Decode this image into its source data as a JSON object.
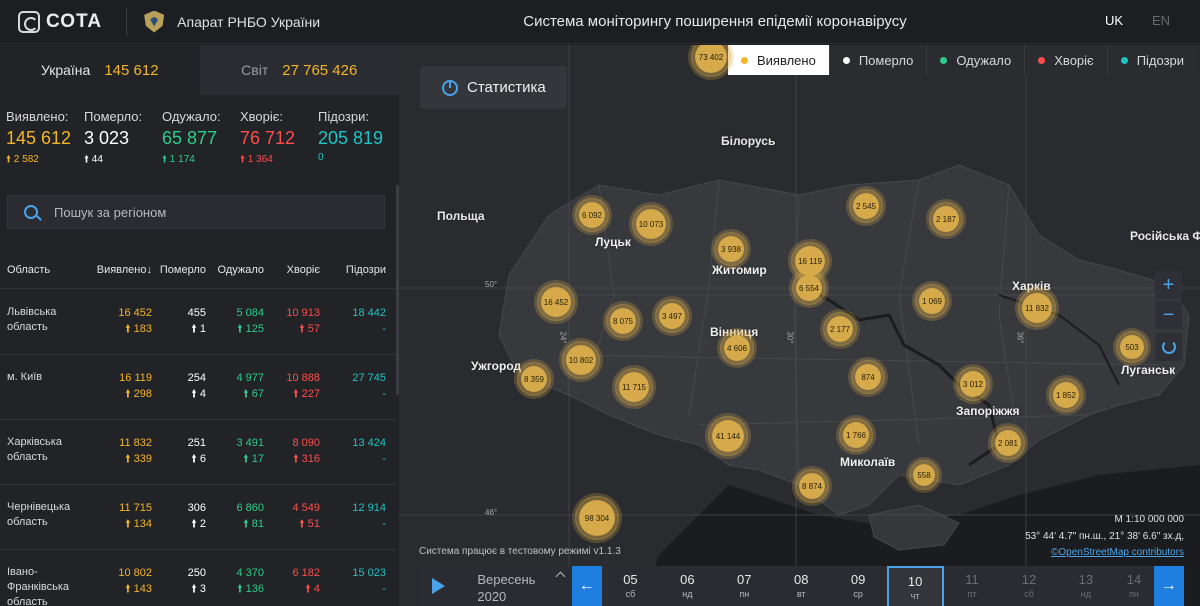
{
  "header": {
    "logo_text": "СОТА",
    "org_name": "Апарат РНБО України",
    "title": "Система моніторингу поширення епідемії коронавірусу",
    "lang_uk": "UK",
    "lang_en": "EN"
  },
  "country_tabs": [
    {
      "name": "Україна",
      "value": "145 612"
    },
    {
      "name": "Світ",
      "value": "27 765 426"
    }
  ],
  "totals": [
    {
      "label": "Виявлено:",
      "value": "145 612",
      "delta": "2 582",
      "color": "#f4b52b"
    },
    {
      "label": "Померло:",
      "value": "3 023",
      "delta": "44",
      "color": "#ffffff"
    },
    {
      "label": "Одужало:",
      "value": "65 877",
      "delta": "1 174",
      "color": "#2ecc8a"
    },
    {
      "label": "Хворіє:",
      "value": "76 712",
      "delta": "1 364",
      "color": "#ff4d4d"
    },
    {
      "label": "Підозри:",
      "value": "205 819",
      "delta": "0",
      "color": "#1ec4c4"
    }
  ],
  "search": {
    "placeholder": "Пошук за регіоном"
  },
  "table": {
    "headers": [
      "Область",
      "Виявлено",
      "Померло",
      "Одужало",
      "Хворіє",
      "Підозри"
    ],
    "sort_indicator": "↓",
    "rows": [
      {
        "region": "Львівська область",
        "detected": "16 452",
        "detected_d": "183",
        "died": "455",
        "died_d": "1",
        "recovered": "5 084",
        "recovered_d": "125",
        "sick": "10 913",
        "sick_d": "57",
        "suspected": "18 442",
        "suspected_d": "-"
      },
      {
        "region": "м. Київ",
        "detected": "16 119",
        "detected_d": "298",
        "died": "254",
        "died_d": "4",
        "recovered": "4 977",
        "recovered_d": "67",
        "sick": "10 888",
        "sick_d": "227",
        "suspected": "27 745",
        "suspected_d": "-"
      },
      {
        "region": "Харківська область",
        "detected": "11 832",
        "detected_d": "339",
        "died": "251",
        "died_d": "6",
        "recovered": "3 491",
        "recovered_d": "17",
        "sick": "8 090",
        "sick_d": "316",
        "suspected": "13 424",
        "suspected_d": "-"
      },
      {
        "region": "Чернівецька область",
        "detected": "11 715",
        "detected_d": "134",
        "died": "306",
        "died_d": "2",
        "recovered": "6 860",
        "recovered_d": "81",
        "sick": "4 549",
        "sick_d": "51",
        "suspected": "12 914",
        "suspected_d": "-"
      },
      {
        "region": "Івано-Франківська область",
        "detected": "10 802",
        "detected_d": "143",
        "died": "250",
        "died_d": "3",
        "recovered": "4 370",
        "recovered_d": "136",
        "sick": "6 182",
        "sick_d": "4",
        "suspected": "15 023",
        "suspected_d": "-"
      }
    ]
  },
  "map": {
    "stat_button": "Статистика",
    "legend": [
      {
        "label": "Виявлено",
        "color": "#f4b52b",
        "active": true
      },
      {
        "label": "Померло",
        "color": "#ffffff",
        "active": false
      },
      {
        "label": "Одужало",
        "color": "#2ecc8a",
        "active": false
      },
      {
        "label": "Хворіє",
        "color": "#ff4d4d",
        "active": false
      },
      {
        "label": "Підозри",
        "color": "#1ec4c4",
        "active": false
      }
    ],
    "places": [
      "Білорусь",
      "Польща",
      "Луцьк",
      "Житомир",
      "Вінниця",
      "Ужгород",
      "Харків",
      "Запоріжжя",
      "Миколаїв",
      "Луганськ",
      "Росiйська Ф"
    ],
    "grid_labels": [
      "50°",
      "46°",
      "24°",
      "30°",
      "36°"
    ],
    "clusters": [
      "73 402",
      "6 092",
      "10 073",
      "3 938",
      "16 119",
      "6 554",
      "2 545",
      "2 187",
      "16 452",
      "8 075",
      "3 497",
      "4 606",
      "2 177",
      "1 069",
      "11 832",
      "503",
      "10 802",
      "8 359",
      "11 715",
      "874",
      "3 012",
      "1 852",
      "41 144",
      "1 766",
      "2 081",
      "558",
      "8 874",
      "98 304"
    ],
    "zoom_in": "+",
    "zoom_out": "−",
    "scale": "М 1:10 000 000",
    "coords": "53° 44' 4.7\" пн.ш., 21° 38' 6.6\" зх.д,",
    "osm": "©OpenStreetMap contributors",
    "test_note": "Система працює в тестовому режимі v1.1.3"
  },
  "timeline": {
    "month": "Вересень",
    "year": "2020",
    "days": [
      {
        "num": "05",
        "wd": "сб"
      },
      {
        "num": "06",
        "wd": "нд"
      },
      {
        "num": "07",
        "wd": "пн"
      },
      {
        "num": "08",
        "wd": "вт"
      },
      {
        "num": "09",
        "wd": "ср"
      },
      {
        "num": "10",
        "wd": "чт"
      },
      {
        "num": "11",
        "wd": "пт"
      },
      {
        "num": "12",
        "wd": "сб"
      },
      {
        "num": "13",
        "wd": "нд"
      },
      {
        "num": "14",
        "wd": "пн"
      }
    ],
    "selected_day": "10"
  }
}
